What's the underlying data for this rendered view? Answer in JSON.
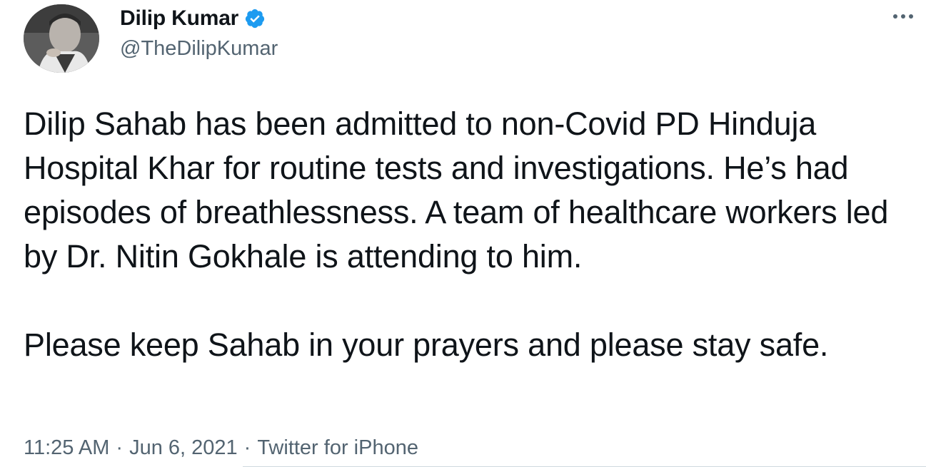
{
  "author": {
    "display_name": "Dilip Kumar",
    "handle": "@TheDilipKumar",
    "verified": true,
    "avatar_icon": "profile-photo",
    "verified_icon": "verified-badge-icon"
  },
  "more_icon": "more-horizontal-icon",
  "tweet": {
    "paragraphs": [
      "Dilip Sahab has been admitted to non-Covid PD Hinduja Hospital Khar for routine tests and investigations. He’s had episodes of breathlessness. A team of healthcare workers led by Dr. Nitin Gokhale is attending to him.",
      "Please keep Sahab in your prayers and please stay safe."
    ]
  },
  "meta": {
    "time": "11:25 AM",
    "separator": "·",
    "date": "Jun 6, 2021",
    "source": "Twitter for iPhone"
  },
  "colors": {
    "text_primary": "#0f1419",
    "text_secondary": "#536471",
    "verified_blue": "#1d9bf0",
    "background": "#ffffff"
  }
}
